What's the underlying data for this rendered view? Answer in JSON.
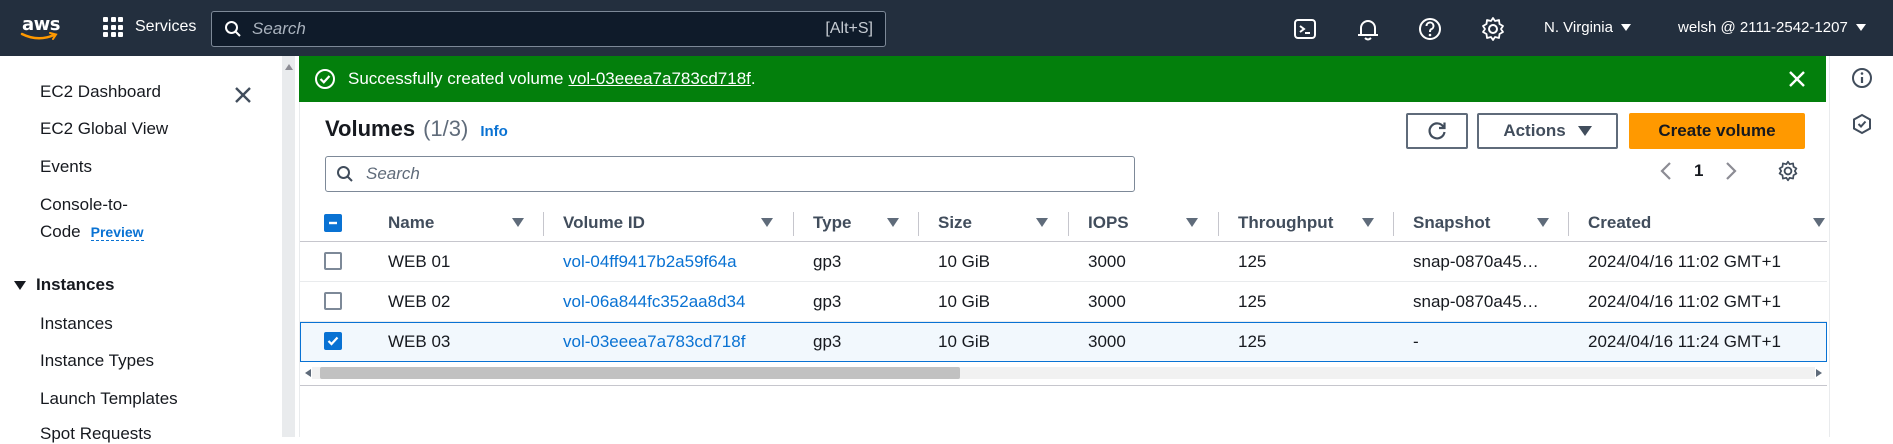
{
  "topnav": {
    "logo_text": "aws",
    "services_label": "Services",
    "search_placeholder": "Search",
    "search_shortcut": "[Alt+S]",
    "region": "N. Virginia",
    "account": "welsh @ 2111-2542-1207",
    "icons": [
      "cloudshell-icon",
      "bell-icon",
      "help-icon",
      "settings-icon"
    ]
  },
  "sidebar": {
    "items_top": [
      "EC2 Dashboard",
      "EC2 Global View",
      "Events"
    ],
    "console_line1": "Console-to-",
    "console_line2": "Code",
    "preview_label": "Preview",
    "section_instances": "Instances",
    "instances_items": [
      "Instances",
      "Instance Types",
      "Launch Templates",
      "Spot Requests"
    ]
  },
  "flash": {
    "message": "Successfully created volume",
    "volume_id": "vol-03eeea7a783cd718f",
    "suffix": ".",
    "color": "#037f0c"
  },
  "volumes": {
    "title": "Volumes",
    "count": "(1/3)",
    "info_label": "Info",
    "actions_label": "Actions",
    "create_label": "Create volume",
    "search_placeholder": "Search",
    "page_number": "1",
    "columns": [
      "Name",
      "Volume ID",
      "Type",
      "Size",
      "IOPS",
      "Throughput",
      "Snapshot",
      "Created"
    ],
    "rows": [
      {
        "selected": false,
        "name": "WEB 01",
        "volume_id": "vol-04ff9417b2a59f64a",
        "type": "gp3",
        "size": "10 GiB",
        "iops": "3000",
        "throughput": "125",
        "snapshot": "snap-0870a45…",
        "created": "2024/04/16 11:02 GMT+1"
      },
      {
        "selected": false,
        "name": "WEB 02",
        "volume_id": "vol-06a844fc352aa8d34",
        "type": "gp3",
        "size": "10 GiB",
        "iops": "3000",
        "throughput": "125",
        "snapshot": "snap-0870a45…",
        "created": "2024/04/16 11:02 GMT+1"
      },
      {
        "selected": true,
        "name": "WEB 03",
        "volume_id": "vol-03eeea7a783cd718f",
        "type": "gp3",
        "size": "10 GiB",
        "iops": "3000",
        "throughput": "125",
        "snapshot": "-",
        "created": "2024/04/16 11:24 GMT+1"
      }
    ]
  }
}
